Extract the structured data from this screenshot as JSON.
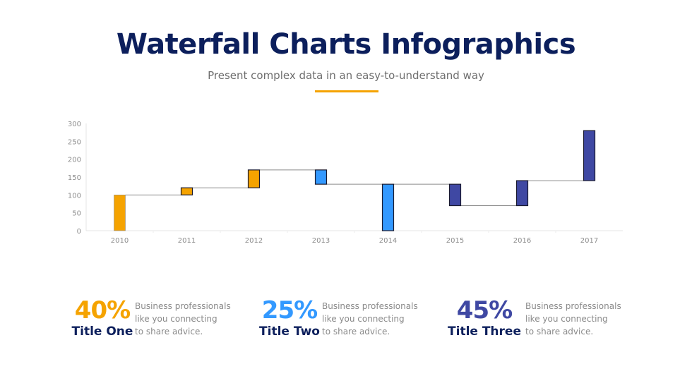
{
  "header": {
    "title": "Waterfall Charts Infographics",
    "subtitle": "Present complex data in an easy-to-understand way",
    "accent_color": "#f5a300"
  },
  "chart_data": {
    "type": "waterfall",
    "title": "",
    "xlabel": "",
    "ylabel": "",
    "categories": [
      "2010",
      "2011",
      "2012",
      "2013",
      "2014",
      "2015",
      "2016",
      "2017"
    ],
    "bars": [
      {
        "category": "2010",
        "start": 0,
        "end": 100,
        "color": "#f5a300"
      },
      {
        "category": "2011",
        "start": 100,
        "end": 120,
        "color": "#f5a300"
      },
      {
        "category": "2012",
        "start": 120,
        "end": 170,
        "color": "#f5a300"
      },
      {
        "category": "2013",
        "start": 170,
        "end": 130,
        "color": "#3399ff"
      },
      {
        "category": "2014",
        "start": 130,
        "end": 0,
        "color": "#3399ff"
      },
      {
        "category": "2015",
        "start": 130,
        "end": 70,
        "color": "#3f48a3"
      },
      {
        "category": "2016",
        "start": 70,
        "end": 140,
        "color": "#3f48a3"
      },
      {
        "category": "2017",
        "start": 140,
        "end": 280,
        "color": "#3f48a3"
      }
    ],
    "connectors": [
      {
        "from": "2010",
        "to": "2011",
        "value": 100
      },
      {
        "from": "2011",
        "to": "2012",
        "value": 120
      },
      {
        "from": "2012",
        "to": "2013",
        "value": 170
      },
      {
        "from": "2013",
        "to": "2015",
        "value": 130
      },
      {
        "from": "2015",
        "to": "2016",
        "value": 70
      },
      {
        "from": "2016",
        "to": "2017",
        "value": 140
      }
    ],
    "yticks": [
      0,
      50,
      100,
      150,
      200,
      250,
      300
    ],
    "ylim": [
      0,
      300
    ],
    "grid": false,
    "legend": "none"
  },
  "stats": [
    {
      "percent": "40%",
      "title": "Title One",
      "color": "#f5a300",
      "desc": [
        "Business professionals",
        "like you connecting",
        "to share advice."
      ]
    },
    {
      "percent": "25%",
      "title": "Title Two",
      "color": "#3399ff",
      "desc": [
        "Business professionals",
        "like you connecting",
        "to share advice."
      ]
    },
    {
      "percent": "45%",
      "title": "Title Three",
      "color": "#3f48a3",
      "desc": [
        "Business professionals",
        "like you connecting",
        "to share advice."
      ]
    }
  ]
}
